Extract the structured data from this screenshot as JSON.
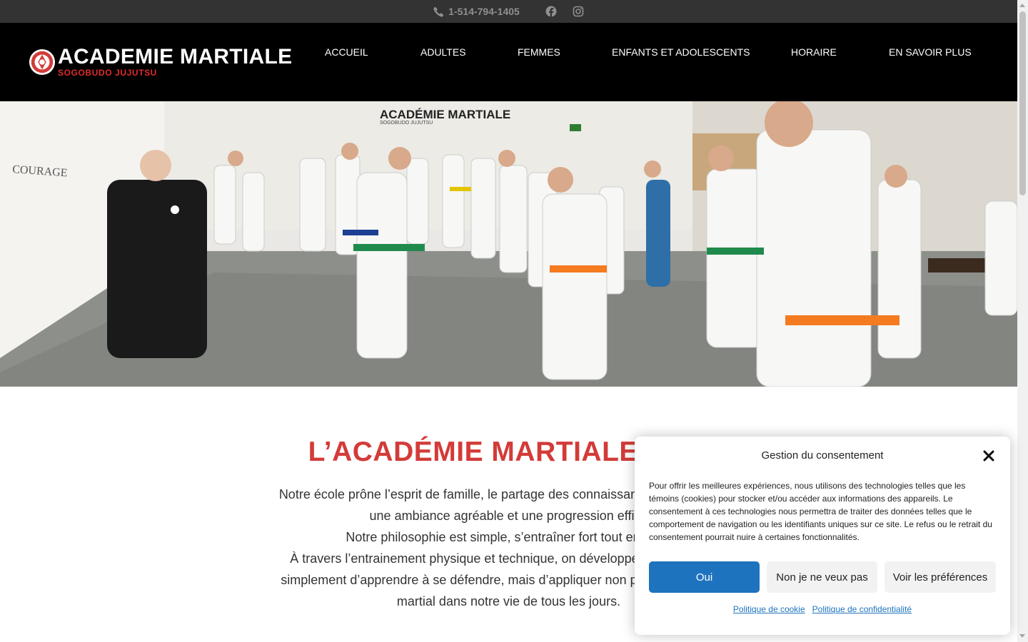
{
  "topbar": {
    "phone": "1-514-794-1405",
    "icons": [
      "phone-icon",
      "facebook-icon",
      "instagram-icon"
    ]
  },
  "header": {
    "logo_title": "ACADEMIE MARTIALE",
    "logo_subtitle": "SOGOBUDO JUJUTSU",
    "nav": [
      "ACCUEIL",
      "ADULTES",
      "FEMMES",
      "ENFANTS ET ADOLESCENTS",
      "HORAIRE",
      "EN SAVOIR PLUS"
    ]
  },
  "hero": {
    "wall_sign_title": "ACADÉMIE MARTIALE",
    "wall_sign_subtitle": "SOGOBUDO JUJUTSU",
    "wall_word": "COURAGE"
  },
  "main": {
    "title": "L’ACADÉMIE MARTIALE SOG",
    "lines": [
      "Notre école prône l’esprit de famille, le partage des connaissances et l’entraide e",
      "une ambiance agréable et une progression effica",
      "Notre philosophie est simple, s’entraîner fort tout en ayan",
      "À travers l’entrainement physique et technique, on développe une force intéri",
      "simplement d’apprendre à se défendre, mais d’appliquer non pas les techniques",
      "martial dans notre vie de tous les jours."
    ]
  },
  "consent": {
    "title": "Gestion du consentement",
    "message": "Pour offrir les meilleures expériences, nous utilisons des technologies telles que les témoins (cookies) pour stocker et/ou accéder aux informations des appareils. Le consentement à ces technologies nous permettra de traiter des données telles que le comportement de navigation ou les identifiants uniques sur ce site. Le refus ou le retrait du consentement pourrait nuire à certaines fonctionnalités.",
    "accept": "Oui",
    "deny": "Non je ne veux pas",
    "preferences": "Voir les préférences",
    "cookie_policy": "Politique de cookie",
    "privacy_policy": "Politique de confidentialité"
  },
  "colors": {
    "topbar": "#333333",
    "header": "#000000",
    "accent_red": "#d33b38",
    "button_blue": "#1e73be"
  }
}
